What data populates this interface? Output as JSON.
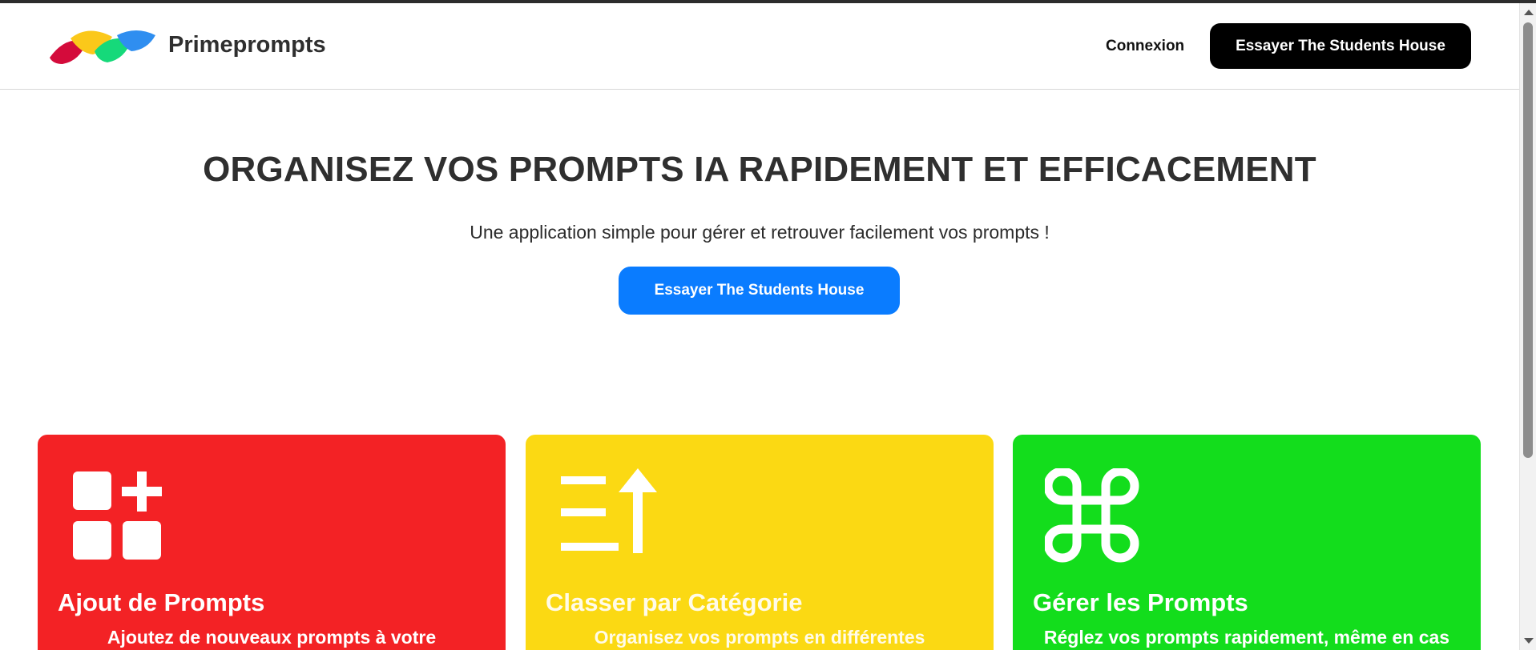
{
  "header": {
    "brand": "Primeprompts",
    "login_label": "Connexion",
    "cta_label": "Essayer The Students House"
  },
  "hero": {
    "title": "ORGANISEZ VOS PROMPTS IA RAPIDEMENT ET EFFICACEMENT",
    "subtitle": "Une application simple pour gérer et retrouver facilement vos prompts !",
    "cta_label": "Essayer The Students House"
  },
  "features": [
    {
      "title": "Ajout de Prompts",
      "description": "Ajoutez de nouveaux prompts à votre",
      "icon": "grid-plus-icon",
      "color": "#f32225"
    },
    {
      "title": "Classer par Catégorie",
      "description": "Organisez vos prompts en différentes",
      "icon": "sort-ascending-icon",
      "color": "#fbd913"
    },
    {
      "title": "Gérer les Prompts",
      "description": "Réglez vos prompts rapidement, même en cas",
      "icon": "command-icon",
      "color": "#13dd1c"
    }
  ],
  "colors": {
    "accent_blue": "#0a7cff",
    "header_cta": "#000000"
  }
}
